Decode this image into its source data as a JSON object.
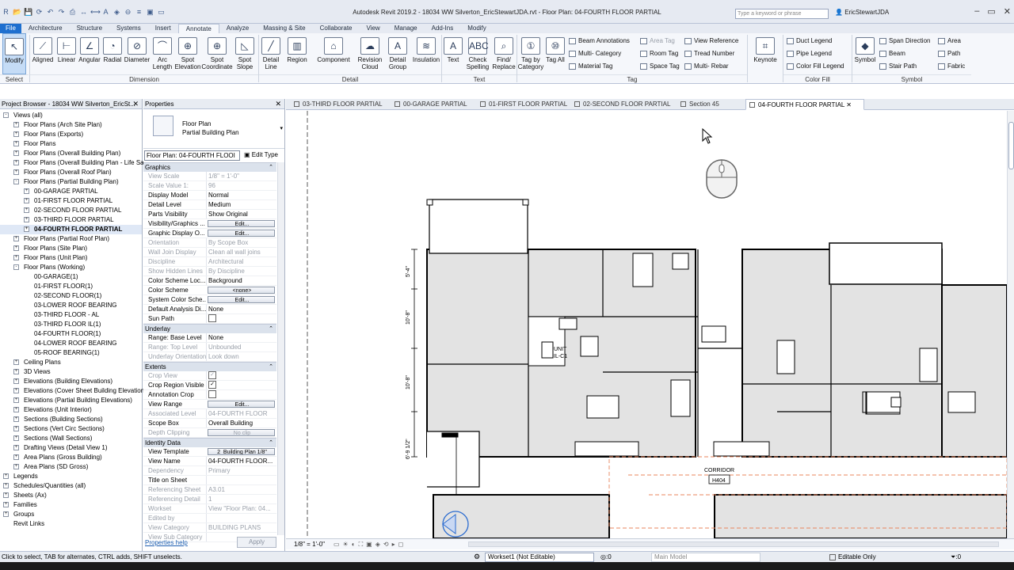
{
  "title_bar": {
    "title": "Autodesk Revit 2019.2 - 18034 WW Silverton_EricStewartJDA.rvt - Floor Plan: 04-FOURTH FLOOR PARTIAL",
    "search_placeholder": "Type a keyword or phrase",
    "user": "EricStewartJDA",
    "qat_icons": [
      "r-logo-icon",
      "open-icon",
      "save-icon",
      "sync-icon",
      "undo-icon",
      "redo-icon",
      "print-icon",
      "measure-icon",
      "dimension-icon",
      "text-icon",
      "3d-view-icon",
      "section-icon",
      "thin-lines-icon",
      "close-hidden-icon",
      "switch-windows-icon"
    ]
  },
  "menu_tabs": [
    "File",
    "Architecture",
    "Structure",
    "Systems",
    "Insert",
    "Annotate",
    "Analyze",
    "Massing & Site",
    "Collaborate",
    "View",
    "Manage",
    "Add-Ins",
    "Modify"
  ],
  "ribbon": {
    "select": {
      "modify": "Modify",
      "group": "Select"
    },
    "dimension_buttons": [
      "Aligned",
      "Linear",
      "Angular",
      "Radial",
      "Diameter",
      "Arc Length",
      "Spot Elevation",
      "Spot Coordinate",
      "Spot Slope"
    ],
    "dimension_group": "Dimension",
    "detail_buttons": [
      "Detail Line",
      "Region",
      "Component",
      "Revision Cloud",
      "Detail Group",
      "Insulation"
    ],
    "detail_group": "Detail",
    "text_buttons": [
      "Text",
      "Check Spelling",
      "Find/ Replace"
    ],
    "text_group": "Text",
    "tag_buttons": [
      "Tag by Category",
      "Tag All"
    ],
    "tag_small": [
      "Beam Annotations",
      "Multi- Category",
      "Material Tag",
      "Area Tag",
      "Room Tag",
      "Space Tag",
      "View Reference",
      "Tread Number",
      "Multi- Rebar"
    ],
    "tag_group": "Tag",
    "keynote": "Keynote",
    "color_fill_small": [
      "Duct Legend",
      "Pipe Legend",
      "Color Fill Legend"
    ],
    "color_fill_group": "Color Fill",
    "symbol": "Symbol",
    "symbol_small": [
      "Span Direction",
      "Beam",
      "Stair Path",
      "Area",
      "Path",
      "Fabric"
    ],
    "symbol_group": "Symbol"
  },
  "project_browser": {
    "title": "Project Browser - 18034 WW Silverton_EricSt...",
    "items": [
      {
        "label": "Views (all)",
        "level": 0,
        "exp": "-"
      },
      {
        "label": "Floor Plans (Arch Site Plan)",
        "level": 1,
        "exp": "+"
      },
      {
        "label": "Floor Plans (Exports)",
        "level": 1,
        "exp": "+"
      },
      {
        "label": "Floor Plans",
        "level": 1,
        "exp": "+"
      },
      {
        "label": "Floor Plans (Overall Building Plan)",
        "level": 1,
        "exp": "+"
      },
      {
        "label": "Floor Plans (Overall Building Plan - Life Sa",
        "level": 1,
        "exp": "+"
      },
      {
        "label": "Floor Plans (Overall Roof Plan)",
        "level": 1,
        "exp": "+"
      },
      {
        "label": "Floor Plans (Partial Building Plan)",
        "level": 1,
        "exp": "-"
      },
      {
        "label": "00-GARAGE PARTIAL",
        "level": 2,
        "exp": "+"
      },
      {
        "label": "01-FIRST FLOOR PARTIAL",
        "level": 2,
        "exp": "+"
      },
      {
        "label": "02-SECOND FLOOR PARTIAL",
        "level": 2,
        "exp": "+"
      },
      {
        "label": "03-THIRD FLOOR PARTIAL",
        "level": 2,
        "exp": "+"
      },
      {
        "label": "04-FOURTH FLOOR PARTIAL",
        "level": 2,
        "exp": "+",
        "bold": true
      },
      {
        "label": "Floor Plans (Partial Roof Plan)",
        "level": 1,
        "exp": "+"
      },
      {
        "label": "Floor Plans (Site Plan)",
        "level": 1,
        "exp": "+"
      },
      {
        "label": "Floor Plans (Unit Plan)",
        "level": 1,
        "exp": "+"
      },
      {
        "label": "Floor Plans (Working)",
        "level": 1,
        "exp": "-"
      },
      {
        "label": "00-GARAGE(1)",
        "level": 2,
        "exp": ""
      },
      {
        "label": "01-FIRST FLOOR(1)",
        "level": 2,
        "exp": ""
      },
      {
        "label": "02-SECOND FLOOR(1)",
        "level": 2,
        "exp": ""
      },
      {
        "label": "03-LOWER ROOF BEARING",
        "level": 2,
        "exp": ""
      },
      {
        "label": "03-THIRD FLOOR - AL",
        "level": 2,
        "exp": ""
      },
      {
        "label": "03-THIRD FLOOR IL(1)",
        "level": 2,
        "exp": ""
      },
      {
        "label": "04-FOURTH FLOOR(1)",
        "level": 2,
        "exp": ""
      },
      {
        "label": "04-LOWER ROOF BEARING",
        "level": 2,
        "exp": ""
      },
      {
        "label": "05-ROOF BEARING(1)",
        "level": 2,
        "exp": ""
      },
      {
        "label": "Ceiling Plans",
        "level": 1,
        "exp": "+"
      },
      {
        "label": "3D Views",
        "level": 1,
        "exp": "+"
      },
      {
        "label": "Elevations (Building Elevations)",
        "level": 1,
        "exp": "+"
      },
      {
        "label": "Elevations (Cover Sheet Building Elevation",
        "level": 1,
        "exp": "+"
      },
      {
        "label": "Elevations (Partial Building Elevations)",
        "level": 1,
        "exp": "+"
      },
      {
        "label": "Elevations (Unit Interior)",
        "level": 1,
        "exp": "+"
      },
      {
        "label": "Sections (Building Sections)",
        "level": 1,
        "exp": "+"
      },
      {
        "label": "Sections (Vert Circ Sections)",
        "level": 1,
        "exp": "+"
      },
      {
        "label": "Sections (Wall Sections)",
        "level": 1,
        "exp": "+"
      },
      {
        "label": "Drafting Views (Detail View 1)",
        "level": 1,
        "exp": "+"
      },
      {
        "label": "Area Plans (Gross Building)",
        "level": 1,
        "exp": "+"
      },
      {
        "label": "Area Plans (SD Gross)",
        "level": 1,
        "exp": "+"
      },
      {
        "label": "Legends",
        "level": 0,
        "exp": "+"
      },
      {
        "label": "Schedules/Quantities (all)",
        "level": 0,
        "exp": "+"
      },
      {
        "label": "Sheets (Ax)",
        "level": 0,
        "exp": "+"
      },
      {
        "label": "Families",
        "level": 0,
        "exp": "+"
      },
      {
        "label": "Groups",
        "level": 0,
        "exp": "+"
      },
      {
        "label": "Revit Links",
        "level": 0,
        "exp": ""
      }
    ]
  },
  "properties": {
    "title": "Properties",
    "type_name_1": "Floor Plan",
    "type_name_2": "Partial Building Plan",
    "instance": "Floor Plan: 04-FOURTH FLOOI",
    "edit_type": "Edit Type",
    "sections": [
      {
        "name": "Graphics",
        "rows": [
          {
            "k": "View Scale",
            "v": "1/8\" = 1'-0\"",
            "dim": true
          },
          {
            "k": "Scale Value    1:",
            "v": "96",
            "dim": true
          },
          {
            "k": "Display Model",
            "v": "Normal"
          },
          {
            "k": "Detail Level",
            "v": "Medium"
          },
          {
            "k": "Parts Visibility",
            "v": "Show Original"
          },
          {
            "k": "Visibility/Graphics ...",
            "v": "Edit...",
            "btn": true
          },
          {
            "k": "Graphic Display O...",
            "v": "Edit...",
            "btn": true
          },
          {
            "k": "Orientation",
            "v": "By Scope Box",
            "dim": true
          },
          {
            "k": "Wall Join Display",
            "v": "Clean all wall joins",
            "dim": true
          },
          {
            "k": "Discipline",
            "v": "Architectural",
            "dim": true
          },
          {
            "k": "Show Hidden Lines",
            "v": "By Discipline",
            "dim": true
          },
          {
            "k": "Color Scheme Loc...",
            "v": "Background"
          },
          {
            "k": "Color Scheme",
            "v": "<none>",
            "btn": true
          },
          {
            "k": "System Color Sche...",
            "v": "Edit...",
            "btn": true
          },
          {
            "k": "Default Analysis Di...",
            "v": "None"
          },
          {
            "k": "Sun Path",
            "v": "",
            "chk": "off"
          }
        ]
      },
      {
        "name": "Underlay",
        "rows": [
          {
            "k": "Range: Base Level",
            "v": "None"
          },
          {
            "k": "Range: Top Level",
            "v": "Unbounded",
            "dim": true
          },
          {
            "k": "Underlay Orientation",
            "v": "Look down",
            "dim": true
          }
        ]
      },
      {
        "name": "Extents",
        "rows": [
          {
            "k": "Crop View",
            "v": "",
            "chk": "on",
            "dim": true
          },
          {
            "k": "Crop Region Visible",
            "v": "",
            "chk": "on"
          },
          {
            "k": "Annotation Crop",
            "v": "",
            "chk": "off"
          },
          {
            "k": "View Range",
            "v": "Edit...",
            "btn": true
          },
          {
            "k": "Associated Level",
            "v": "04-FOURTH FLOOR",
            "dim": true
          },
          {
            "k": "Scope Box",
            "v": "Overall Building"
          },
          {
            "k": "Depth Clipping",
            "v": "No clip",
            "btn": true,
            "dim": true
          }
        ]
      },
      {
        "name": "Identity Data",
        "rows": [
          {
            "k": "View Template",
            "v": "2_Building Plan 1/8\"",
            "btn": true
          },
          {
            "k": "View Name",
            "v": "04-FOURTH FLOOR..."
          },
          {
            "k": "Dependency",
            "v": "Primary",
            "dim": true
          },
          {
            "k": "Title on Sheet",
            "v": ""
          },
          {
            "k": "Referencing Sheet",
            "v": "A3.01",
            "dim": true
          },
          {
            "k": "Referencing Detail",
            "v": "1",
            "dim": true
          },
          {
            "k": "Workset",
            "v": "View \"Floor Plan: 04...",
            "dim": true
          },
          {
            "k": "Edited by",
            "v": "",
            "dim": true
          },
          {
            "k": "View Category",
            "v": "BUILDING PLANS",
            "dim": true
          },
          {
            "k": "View Sub Category",
            "v": "",
            "dim": true
          }
        ]
      }
    ],
    "help": "Properties help",
    "apply": "Apply"
  },
  "view_tabs": [
    {
      "label": "03-THIRD FLOOR PARTIAL"
    },
    {
      "label": "00-GARAGE PARTIAL"
    },
    {
      "label": "01-FIRST FLOOR PARTIAL"
    },
    {
      "label": "02-SECOND FLOOR PARTIAL"
    },
    {
      "label": "Section 45"
    },
    {
      "label": "04-FOURTH FLOOR PARTIAL",
      "active": true
    }
  ],
  "drawing": {
    "unit_label_1": "UNIT",
    "unit_label_2": "IL-C1",
    "corridor": "CORRIDOR",
    "corridor_tag": "H404",
    "dims": [
      "5'-4\"",
      "10'-8\"",
      "10'-8\"",
      "6'-9 1/2\""
    ]
  },
  "view_control": {
    "scale": "1/8\" = 1'-0\""
  },
  "status": {
    "text": "Click to select, TAB for alternates, CTRL adds, SHIFT unselects.",
    "workset": "Workset1 (Not Editable)",
    "active_count": ":0",
    "main_model": "Main Model",
    "editable_only": "Editable Only",
    "filter_count": ":0"
  }
}
